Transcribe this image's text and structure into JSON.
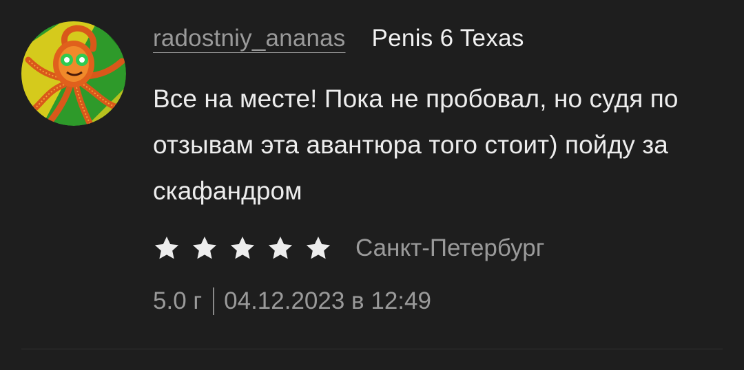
{
  "review": {
    "avatar_icon": "octopus-avatar-icon",
    "username": "radostniy_ananas",
    "product": "Penis 6 Texas",
    "text": "Все на месте! Пока не пробовал, но судя по отзывам эта авантюра того стоит) пойду за скафандром",
    "rating": 5,
    "rating_max": 5,
    "city": "Санкт-Петербург",
    "weight": "5.0 г",
    "date": "04.12.2023 в 12:49"
  },
  "colors": {
    "background": "#1e1e1e",
    "primary_text": "#ededed",
    "secondary_text": "#9a9a9a",
    "star": "#ededed"
  }
}
